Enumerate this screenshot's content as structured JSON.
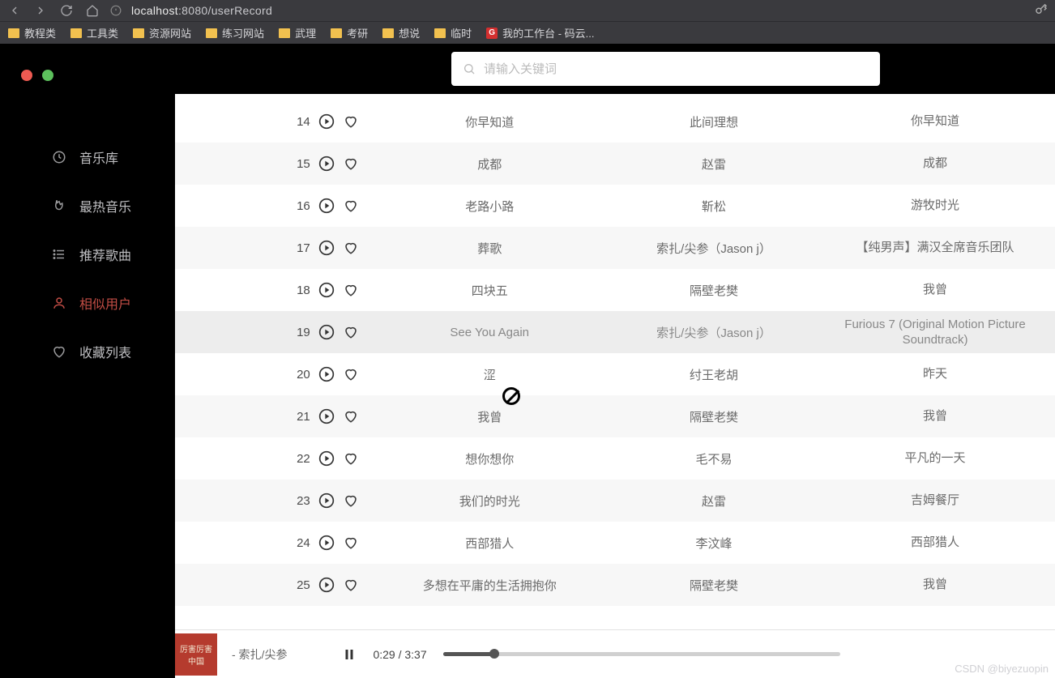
{
  "browser": {
    "url_host": "localhost",
    "url_port": ":8080",
    "url_path": "/userRecord"
  },
  "bookmarks": [
    {
      "label": "教程类",
      "kind": "folder"
    },
    {
      "label": "工具类",
      "kind": "folder"
    },
    {
      "label": "资源网站",
      "kind": "folder"
    },
    {
      "label": "练习网站",
      "kind": "folder"
    },
    {
      "label": "武理",
      "kind": "folder"
    },
    {
      "label": "考研",
      "kind": "folder"
    },
    {
      "label": "想说",
      "kind": "folder"
    },
    {
      "label": "临时",
      "kind": "folder"
    },
    {
      "label": "我的工作台 - 码云...",
      "kind": "badge",
      "badge": "G"
    }
  ],
  "search": {
    "placeholder": "请输入关键词"
  },
  "sidebar": {
    "items": [
      {
        "icon": "note",
        "label": "音乐库"
      },
      {
        "icon": "fire",
        "label": "最热音乐"
      },
      {
        "icon": "list",
        "label": "推荐歌曲"
      },
      {
        "icon": "user",
        "label": "相似用户",
        "active": true
      },
      {
        "icon": "heart",
        "label": "收藏列表"
      }
    ]
  },
  "tracks": [
    {
      "idx": 14,
      "title": "你早知道",
      "artist": "此间理想",
      "album": "你早知道"
    },
    {
      "idx": 15,
      "title": "成都",
      "artist": "赵雷",
      "album": "成都"
    },
    {
      "idx": 16,
      "title": "老路小路",
      "artist": "靳松",
      "album": "游牧时光"
    },
    {
      "idx": 17,
      "title": "葬歌",
      "artist": "索扎/尖参（Jason j）",
      "album": "【纯男声】满汉全席音乐团队"
    },
    {
      "idx": 18,
      "title": "四块五",
      "artist": "隔壁老樊",
      "album": "我曾"
    },
    {
      "idx": 19,
      "title": "See You Again",
      "artist": "索扎/尖参（Jason j）",
      "album": "Furious 7 (Original Motion Picture Soundtrack)",
      "hover": true
    },
    {
      "idx": 20,
      "title": "涩",
      "artist": "纣王老胡",
      "album": "昨天"
    },
    {
      "idx": 21,
      "title": "我曾",
      "artist": "隔壁老樊",
      "album": "我曾"
    },
    {
      "idx": 22,
      "title": "想你想你",
      "artist": "毛不易",
      "album": "平凡的一天"
    },
    {
      "idx": 23,
      "title": "我们的时光",
      "artist": "赵雷",
      "album": "吉姆餐厅"
    },
    {
      "idx": 24,
      "title": "西部猎人",
      "artist": "李汶峰",
      "album": "西部猎人"
    },
    {
      "idx": 25,
      "title": "多想在平庸的生活拥抱你",
      "artist": "隔壁老樊",
      "album": "我曾"
    }
  ],
  "player": {
    "artwork_text": "厉害厉害中国",
    "now_playing": "- 索扎/尖参",
    "current_time": "0:29",
    "total_time": "3:37",
    "progress_pct": 13
  },
  "watermark": "CSDN @biyezuopin"
}
